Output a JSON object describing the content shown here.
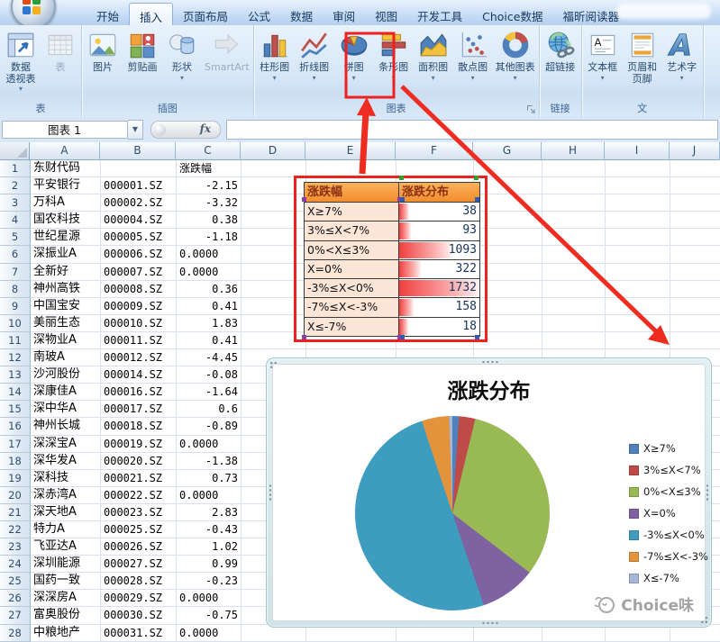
{
  "window": {
    "tabs": [
      "开始",
      "插入",
      "页面布局",
      "公式",
      "数据",
      "审阅",
      "视图",
      "开发工具",
      "Choice数据",
      "福昕阅读器"
    ],
    "active_tab": "插入"
  },
  "ribbon": {
    "groups": [
      {
        "label": "表",
        "buttons": [
          {
            "label": "数据透视表",
            "lines": [
              "数据",
              "透视表"
            ],
            "icon": "pivot-table-icon",
            "dropdown": true
          },
          {
            "label": "表",
            "icon": "table-icon",
            "disabled": true
          }
        ]
      },
      {
        "label": "插图",
        "buttons": [
          {
            "label": "图片",
            "icon": "picture-icon"
          },
          {
            "label": "剪贴画",
            "icon": "clipart-icon"
          },
          {
            "label": "形状",
            "icon": "shapes-icon",
            "dropdown": true
          },
          {
            "label": "SmartArt",
            "icon": "smartart-icon",
            "disabled": true
          }
        ]
      },
      {
        "label": "图表",
        "dialog_launcher": true,
        "buttons": [
          {
            "label": "柱形图",
            "icon": "column-chart-icon",
            "dropdown": true
          },
          {
            "label": "折线图",
            "icon": "line-chart-icon",
            "dropdown": true
          },
          {
            "label": "饼图",
            "icon": "pie-chart-icon",
            "dropdown": true,
            "highlighted": true
          },
          {
            "label": "条形图",
            "icon": "bar-chart-icon",
            "dropdown": true
          },
          {
            "label": "面积图",
            "icon": "area-chart-icon",
            "dropdown": true
          },
          {
            "label": "散点图",
            "icon": "scatter-chart-icon",
            "dropdown": true
          },
          {
            "label": "其他图表",
            "icon": "other-charts-icon",
            "dropdown": true
          }
        ]
      },
      {
        "label": "链接",
        "buttons": [
          {
            "label": "超链接",
            "icon": "hyperlink-icon"
          }
        ]
      },
      {
        "label": "文",
        "buttons": [
          {
            "label": "文本框",
            "icon": "textbox-icon",
            "dropdown": true
          },
          {
            "label": "页眉和页脚",
            "lines": [
              "页眉和",
              "页脚"
            ],
            "icon": "header-footer-icon"
          },
          {
            "label": "艺术字",
            "icon": "wordart-icon",
            "dropdown": true
          }
        ]
      }
    ]
  },
  "formula_bar": {
    "name_box": "图表 1",
    "fx": "fx"
  },
  "sheet": {
    "col_headers": [
      "A",
      "B",
      "C",
      "D",
      "E",
      "F",
      "G",
      "H",
      "I",
      "J"
    ],
    "rows": [
      {
        "n": "1",
        "a": "东财代码",
        "b": "",
        "c": "涨跌幅"
      },
      {
        "n": "2",
        "a": "平安银行",
        "b": "000001.SZ",
        "c": "-2.15"
      },
      {
        "n": "3",
        "a": "万科A",
        "b": "000002.SZ",
        "c": "-3.32"
      },
      {
        "n": "4",
        "a": "国农科技",
        "b": "000004.SZ",
        "c": "0.38"
      },
      {
        "n": "5",
        "a": "世纪星源",
        "b": "000005.SZ",
        "c": "-1.18"
      },
      {
        "n": "6",
        "a": "深振业A",
        "b": "000006.SZ",
        "c": "0.0000"
      },
      {
        "n": "7",
        "a": "全新好",
        "b": "000007.SZ",
        "c": "0.0000"
      },
      {
        "n": "8",
        "a": "神州高铁",
        "b": "000008.SZ",
        "c": "0.36"
      },
      {
        "n": "9",
        "a": "中国宝安",
        "b": "000009.SZ",
        "c": "0.41"
      },
      {
        "n": "10",
        "a": "美丽生态",
        "b": "000010.SZ",
        "c": "1.83"
      },
      {
        "n": "11",
        "a": "深物业A",
        "b": "000011.SZ",
        "c": "0.41"
      },
      {
        "n": "12",
        "a": "南玻A",
        "b": "000012.SZ",
        "c": "-4.45"
      },
      {
        "n": "13",
        "a": "沙河股份",
        "b": "000014.SZ",
        "c": "-0.08"
      },
      {
        "n": "14",
        "a": "深康佳A",
        "b": "000016.SZ",
        "c": "-1.64"
      },
      {
        "n": "15",
        "a": "深中华A",
        "b": "000017.SZ",
        "c": "0.6"
      },
      {
        "n": "16",
        "a": "神州长城",
        "b": "000018.SZ",
        "c": "-0.89"
      },
      {
        "n": "17",
        "a": "深深宝A",
        "b": "000019.SZ",
        "c": "0.0000"
      },
      {
        "n": "18",
        "a": "深华发A",
        "b": "000020.SZ",
        "c": "-1.38"
      },
      {
        "n": "19",
        "a": "深科技",
        "b": "000021.SZ",
        "c": "0.73"
      },
      {
        "n": "20",
        "a": "深赤湾A",
        "b": "000022.SZ",
        "c": "0.0000"
      },
      {
        "n": "21",
        "a": "深天地A",
        "b": "000023.SZ",
        "c": "2.83"
      },
      {
        "n": "22",
        "a": "特力A",
        "b": "000025.SZ",
        "c": "-0.43"
      },
      {
        "n": "23",
        "a": "飞亚达A",
        "b": "000026.SZ",
        "c": "1.02"
      },
      {
        "n": "24",
        "a": "深圳能源",
        "b": "000027.SZ",
        "c": "0.99"
      },
      {
        "n": "25",
        "a": "国药一致",
        "b": "000028.SZ",
        "c": "-0.23"
      },
      {
        "n": "26",
        "a": "深深房A",
        "b": "000029.SZ",
        "c": "0.0000"
      },
      {
        "n": "27",
        "a": "富奥股份",
        "b": "000030.SZ",
        "c": "-0.75"
      },
      {
        "n": "28",
        "a": "中粮地产",
        "b": "000031.SZ",
        "c": "0.0000"
      }
    ]
  },
  "range_table": {
    "headers": [
      "涨跌幅",
      "涨跌分布"
    ],
    "rows": [
      {
        "range": "X≥7%",
        "count": 38
      },
      {
        "range": "3%≤X<7%",
        "count": 93
      },
      {
        "range": "0%<X≤3%",
        "count": 1093
      },
      {
        "range": "X=0%",
        "count": 322
      },
      {
        "range": "-3%≤X<0%",
        "count": 1732
      },
      {
        "range": "-7%≤X<-3%",
        "count": 158
      },
      {
        "range": "X≤-7%",
        "count": 18
      }
    ]
  },
  "chart_data": {
    "type": "pie",
    "title": "涨跌分布",
    "categories": [
      "X≥7%",
      "3%≤X<7%",
      "0%<X≤3%",
      "X=0%",
      "-3%≤X<0%",
      "-7%≤X<-3%",
      "X≤-7%"
    ],
    "values": [
      38,
      93,
      1093,
      322,
      1732,
      158,
      18
    ],
    "colors": [
      "#4F81BD",
      "#BE4B48",
      "#98B954",
      "#7E62A1",
      "#3E9DBF",
      "#E3933C",
      "#A3B8D9"
    ],
    "legend_position": "right",
    "grid": false
  },
  "watermark": {
    "text": "Choice味"
  }
}
